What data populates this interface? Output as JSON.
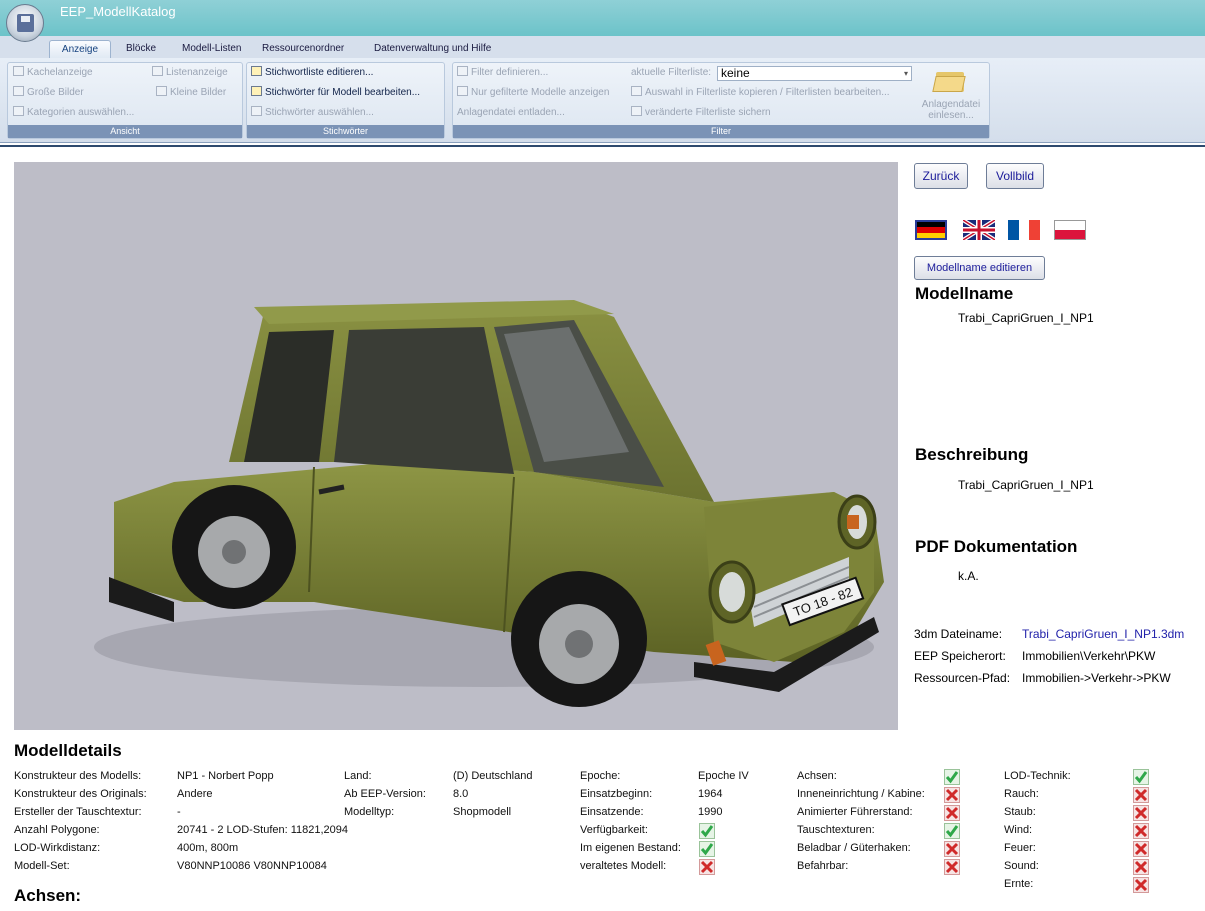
{
  "app": {
    "title": "EEP_ModellKatalog"
  },
  "tabs": [
    "Anzeige",
    "Blöcke",
    "Modell-Listen",
    "Ressourcenordner",
    "Datenverwaltung und Hilfe"
  ],
  "ribbon": {
    "ansicht": {
      "caption": "Ansicht",
      "kachelanzeige": "Kachelanzeige",
      "listenanzeige": "Listenanzeige",
      "grosse_bilder": "Große Bilder",
      "kleine_bilder": "Kleine Bilder",
      "kategorien": "Kategorien auswählen..."
    },
    "stichwoerter": {
      "caption": "Stichwörter",
      "editieren": "Stichwortliste editieren...",
      "bearbeiten": "Stichwörter für Modell bearbeiten...",
      "auswaehlen": "Stichwörter auswählen..."
    },
    "filter": {
      "caption": "Filter",
      "definieren": "Filter definieren...",
      "nur_gefilterte": "Nur gefilterte Modelle anzeigen",
      "anlagendatei_entladen": "Anlagendatei entladen...",
      "aktuelle_label": "aktuelle Filterliste:",
      "aktuelle_value": "keine",
      "auswahl_kopieren": "Auswahl in Filterliste kopieren / Filterlisten bearbeiten...",
      "veraenderte": "veränderte Filterliste sichern",
      "anlagendatei_einlesen": "Anlagendatei einlesen..."
    }
  },
  "buttons": {
    "zurueck": "Zurück",
    "vollbild": "Vollbild",
    "modellname_editieren": "Modellname editieren"
  },
  "flags": [
    "de-flag",
    "uk-flag",
    "fr-flag",
    "pl-flag"
  ],
  "modellname": {
    "heading": "Modellname",
    "value": "Trabi_CapriGruen_I_NP1"
  },
  "beschreibung": {
    "heading": "Beschreibung",
    "value": "Trabi_CapriGruen_I_NP1"
  },
  "pdf": {
    "heading": "PDF Dokumentation",
    "value": "k.A."
  },
  "files": {
    "dateiname_label": "3dm Dateiname:",
    "dateiname_value": "Trabi_CapriGruen_I_NP1.3dm",
    "speicherort_label": "EEP Speicherort:",
    "speicherort_value": "Immobilien\\Verkehr\\PKW",
    "pfad_label": "Ressourcen-Pfad:",
    "pfad_value": "Immobilien->Verkehr->PKW"
  },
  "car": {
    "plate": "TO 18 - 82"
  },
  "details": {
    "heading": "Modelldetails",
    "col1": [
      {
        "label": "Konstrukteur des Modells:",
        "value": "NP1 - Norbert Popp"
      },
      {
        "label": "Konstrukteur des Originals:",
        "value": "Andere"
      },
      {
        "label": "Ersteller der Tauschtextur:",
        "value": "-"
      },
      {
        "label": "Anzahl Polygone:",
        "value": "20741 - 2 LOD-Stufen: 11821,2094"
      },
      {
        "label": "LOD-Wirkdistanz:",
        "value": "400m, 800m"
      },
      {
        "label": "Modell-Set:",
        "value": "V80NNP10086  V80NNP10084"
      }
    ],
    "col2": [
      {
        "label": "Land:",
        "value": "(D) Deutschland"
      },
      {
        "label": "Ab EEP-Version:",
        "value": "8.0"
      },
      {
        "label": "Modelltyp:",
        "value": "Shopmodell"
      }
    ],
    "col3": [
      {
        "label": "Epoche:",
        "value": "Epoche IV"
      },
      {
        "label": "Einsatzbeginn:",
        "value": "1964"
      },
      {
        "label": "Einsatzende:",
        "value": "1990"
      },
      {
        "label": "Verfügbarkeit:",
        "check": true
      },
      {
        "label": "Im eigenen Bestand:",
        "check": true
      },
      {
        "label": "veraltetes Modell:",
        "check": false
      }
    ],
    "col4": [
      {
        "label": "Achsen:",
        "check": true
      },
      {
        "label": "Inneneinrichtung / Kabine:",
        "check": false
      },
      {
        "label": "Animierter Führerstand:",
        "check": false
      },
      {
        "label": "Tauschtexturen:",
        "check": true
      },
      {
        "label": "Beladbar / Güterhaken:",
        "check": false
      },
      {
        "label": "Befahrbar:",
        "check": false
      }
    ],
    "col5": [
      {
        "label": "LOD-Technik:",
        "check": true
      },
      {
        "label": "Rauch:",
        "check": false
      },
      {
        "label": "Staub:",
        "check": false
      },
      {
        "label": "Wind:",
        "check": false
      },
      {
        "label": "Feuer:",
        "check": false
      },
      {
        "label": "Sound:",
        "check": false
      },
      {
        "label": "Ernte:",
        "check": false
      }
    ]
  },
  "achsen": {
    "heading": "Achsen:"
  },
  "colors": {
    "titlebar": "#79c8ce",
    "ribbon": "#dfe7f2",
    "car": "#7a8236",
    "check": "#2fa84a",
    "cross": "#d02a2a"
  }
}
